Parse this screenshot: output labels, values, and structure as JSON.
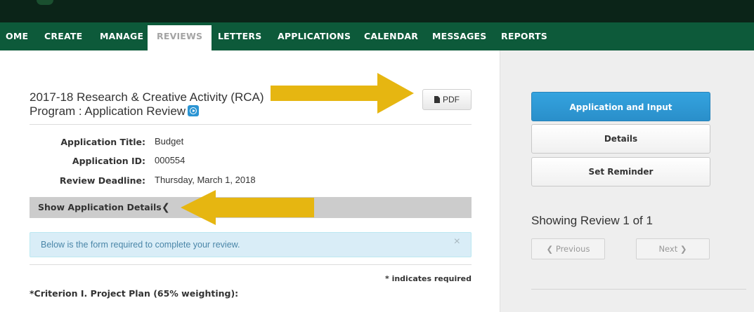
{
  "nav": {
    "items": [
      {
        "label": "OME"
      },
      {
        "label": "CREATE"
      },
      {
        "label": "MANAGE"
      },
      {
        "label": "REVIEWS"
      },
      {
        "label": "LETTERS"
      },
      {
        "label": "APPLICATIONS"
      },
      {
        "label": "CALENDAR"
      },
      {
        "label": "MESSAGES"
      },
      {
        "label": "REPORTS"
      }
    ],
    "active": "REVIEWS"
  },
  "main": {
    "title_line1": "2017-18 Research & Creative Activity (RCA)",
    "title_line2": "Program : Application Review",
    "pdf_label": "PDF",
    "fields": [
      {
        "label": "Application Title:",
        "value": "Budget"
      },
      {
        "label": "Application ID:",
        "value": "000554"
      },
      {
        "label": "Review Deadline:",
        "value": "Thursday, March 1, 2018"
      }
    ],
    "details_toggle_label": "Show Application Details",
    "details_toggle_chevron": "❮",
    "alert_text": "Below is the form required to complete your review.",
    "alert_close": "×",
    "required_note": "* indicates required",
    "criterion_label": "*Criterion I. Project Plan (65% weighting):"
  },
  "sidebar": {
    "buttons": [
      {
        "label": "Application and Input"
      },
      {
        "label": "Details"
      },
      {
        "label": "Set Reminder"
      }
    ],
    "showing_text": "Showing Review 1 of 1",
    "prev_label": "Previous",
    "next_label": "Next",
    "prev_chevron": "❮",
    "next_chevron": "❯"
  },
  "colors": {
    "nav_green": "#0d5a3a",
    "top_bar": "#0b2418",
    "primary_blue": "#2c9bd6",
    "annotation_arrow": "#e6b611",
    "alert_bg": "#d9edf7"
  }
}
